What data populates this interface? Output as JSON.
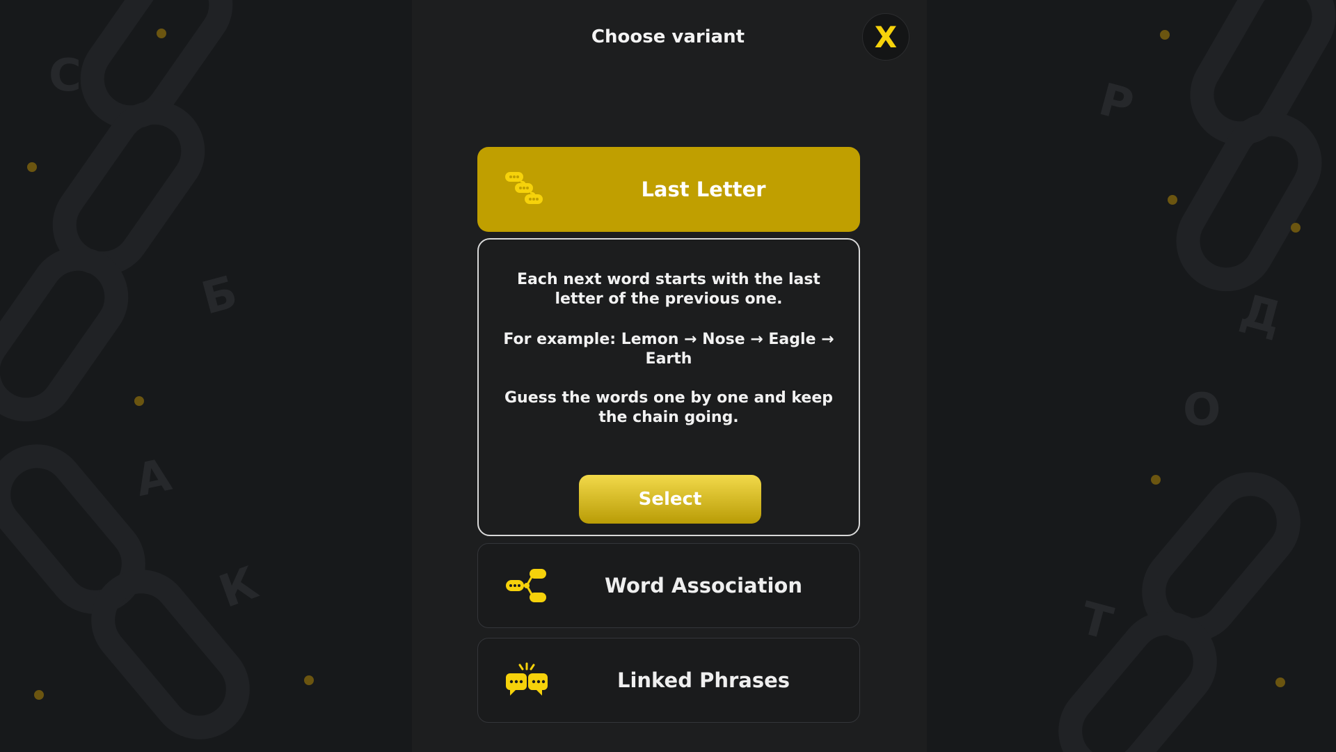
{
  "header": {
    "title": "Choose variant",
    "close_label": "X"
  },
  "variants": [
    {
      "label": "Last Letter",
      "icon": "chat-chain-icon",
      "selected": true
    },
    {
      "label": "Word Association",
      "icon": "chat-branch-icon",
      "selected": false
    },
    {
      "label": "Linked Phrases",
      "icon": "linked-chat-icon",
      "selected": false
    }
  ],
  "description": {
    "paragraph1": "Each next word starts with the last letter of the previous one.",
    "paragraph2": "For example: Lemon → Nose → Eagle → Earth",
    "paragraph3": "Guess the words one by one and keep the chain going.",
    "select_label": "Select"
  },
  "background_letters": [
    "С",
    "Б",
    "А",
    "К",
    "Р",
    "Д",
    "О",
    "Т"
  ],
  "colors": {
    "accent": "#c09f00",
    "accent_bright": "#f6d20b",
    "background": "#17191b",
    "panel": "#1d1e1f"
  }
}
